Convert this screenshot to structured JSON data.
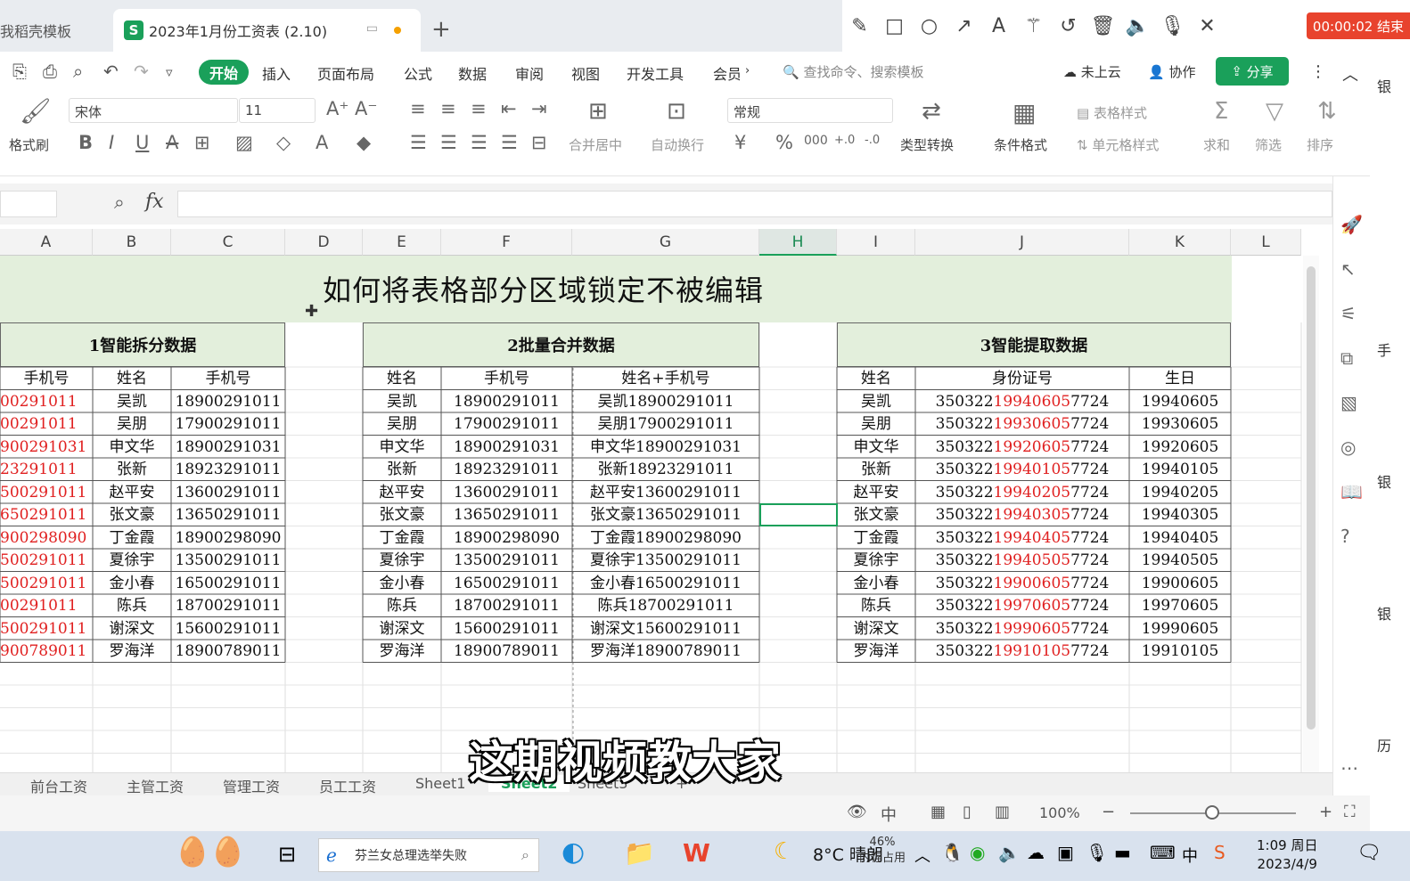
{
  "tabs": {
    "prev_tab": "我稻壳模板",
    "active_tab": "2023年1月份工资表 (2.10)",
    "active_logo": "S"
  },
  "recording": {
    "timer": "00:00:02 结束"
  },
  "menu": {
    "active": "开始",
    "items": [
      "插入",
      "页面布局",
      "公式",
      "数据",
      "审阅",
      "视图",
      "开发工具",
      "会员"
    ],
    "search_placeholder": "查找命令、搜索模板",
    "cloud": "未上云",
    "collab": "协作",
    "share": "分享"
  },
  "ribbon": {
    "format_painter": "格式刷",
    "font_name": "宋体",
    "font_size": "11",
    "number_format": "常规",
    "merge_center": "合并居中",
    "auto_wrap": "自动换行",
    "type_convert": "类型转换",
    "conditional_format": "条件格式",
    "table_style": "表格样式",
    "cell_style": "单元格样式",
    "sum": "求和",
    "filter": "筛选",
    "sort": "排序"
  },
  "formula_bar": {
    "fx": "fx",
    "value": ""
  },
  "columns": [
    "A",
    "B",
    "C",
    "D",
    "E",
    "F",
    "G",
    "H",
    "I",
    "J",
    "K",
    "L"
  ],
  "selected_column": "H",
  "sheet": {
    "title": "如何将表格部分区域锁定不被编辑",
    "section1": {
      "header": "1智能拆分数据",
      "col_headers": [
        "手机号",
        "姓名",
        "手机号"
      ],
      "rows": [
        [
          "00291011",
          "吴凯",
          "18900291011"
        ],
        [
          "00291011",
          "吴朋",
          "17900291011"
        ],
        [
          "900291031",
          "申文华",
          "18900291031"
        ],
        [
          "23291011",
          "张新",
          "18923291011"
        ],
        [
          "500291011",
          "赵平安",
          "13600291011"
        ],
        [
          "650291011",
          "张文豪",
          "13650291011"
        ],
        [
          "900298090",
          "丁金霞",
          "18900298090"
        ],
        [
          "500291011",
          "夏徐宇",
          "13500291011"
        ],
        [
          "500291011",
          "金小春",
          "16500291011"
        ],
        [
          "00291011",
          "陈兵",
          "18700291011"
        ],
        [
          "500291011",
          "谢深文",
          "15600291011"
        ],
        [
          "900789011",
          "罗海洋",
          "18900789011"
        ]
      ]
    },
    "section2": {
      "header": "2批量合并数据",
      "col_headers": [
        "姓名",
        "手机号",
        "姓名+手机号"
      ],
      "rows": [
        [
          "吴凯",
          "18900291011",
          "吴凯18900291011"
        ],
        [
          "吴朋",
          "17900291011",
          "吴朋17900291011"
        ],
        [
          "申文华",
          "18900291031",
          "申文华18900291031"
        ],
        [
          "张新",
          "18923291011",
          "张新18923291011"
        ],
        [
          "赵平安",
          "13600291011",
          "赵平安13600291011"
        ],
        [
          "张文豪",
          "13650291011",
          "张文豪13650291011"
        ],
        [
          "丁金霞",
          "18900298090",
          "丁金霞18900298090"
        ],
        [
          "夏徐宇",
          "13500291011",
          "夏徐宇13500291011"
        ],
        [
          "金小春",
          "16500291011",
          "金小春16500291011"
        ],
        [
          "陈兵",
          "18700291011",
          "陈兵18700291011"
        ],
        [
          "谢深文",
          "15600291011",
          "谢深文15600291011"
        ],
        [
          "罗海洋",
          "18900789011",
          "罗海洋18900789011"
        ]
      ]
    },
    "section3": {
      "header": "3智能提取数据",
      "col_headers": [
        "姓名",
        "身份证号",
        "生日"
      ],
      "id_prefix": "350322",
      "id_suffix": "7724",
      "rows": [
        [
          "吴凯",
          "19940605",
          "19940605"
        ],
        [
          "吴朋",
          "19930605",
          "19930605"
        ],
        [
          "申文华",
          "19920605",
          "19920605"
        ],
        [
          "张新",
          "19940105",
          "19940105"
        ],
        [
          "赵平安",
          "19940205",
          "19940205"
        ],
        [
          "张文豪",
          "19940305",
          "19940305"
        ],
        [
          "丁金霞",
          "19940405",
          "19940405"
        ],
        [
          "夏徐宇",
          "19940505",
          "19940505"
        ],
        [
          "金小春",
          "19900605",
          "19900605"
        ],
        [
          "陈兵",
          "19970605",
          "19970605"
        ],
        [
          "谢深文",
          "19990605",
          "19990605"
        ],
        [
          "罗海洋",
          "19910105",
          "19910105"
        ]
      ]
    }
  },
  "sheet_tabs": [
    "前台工资",
    "主管工资",
    "管理工资",
    "员工工资",
    "Sheet1",
    "Sheet2",
    "Sheet3"
  ],
  "active_sheet_tab": "Sheet2",
  "status": {
    "zoom": "100%"
  },
  "subtitle": "这期视频教大家",
  "right_strip": [
    "银",
    "手",
    "银",
    "银",
    "历"
  ],
  "taskbar": {
    "search_text": "芬兰女总理选举失败",
    "weather": "8°C 晴朗",
    "mem_percent": "46%",
    "mem_label": "内存占用",
    "ime": "中",
    "time": "1:09 周日",
    "date": "2023/4/9"
  },
  "colors": {
    "accent": "#1aa05a",
    "section_bg": "#e3efdc",
    "red_text": "#e02020"
  }
}
